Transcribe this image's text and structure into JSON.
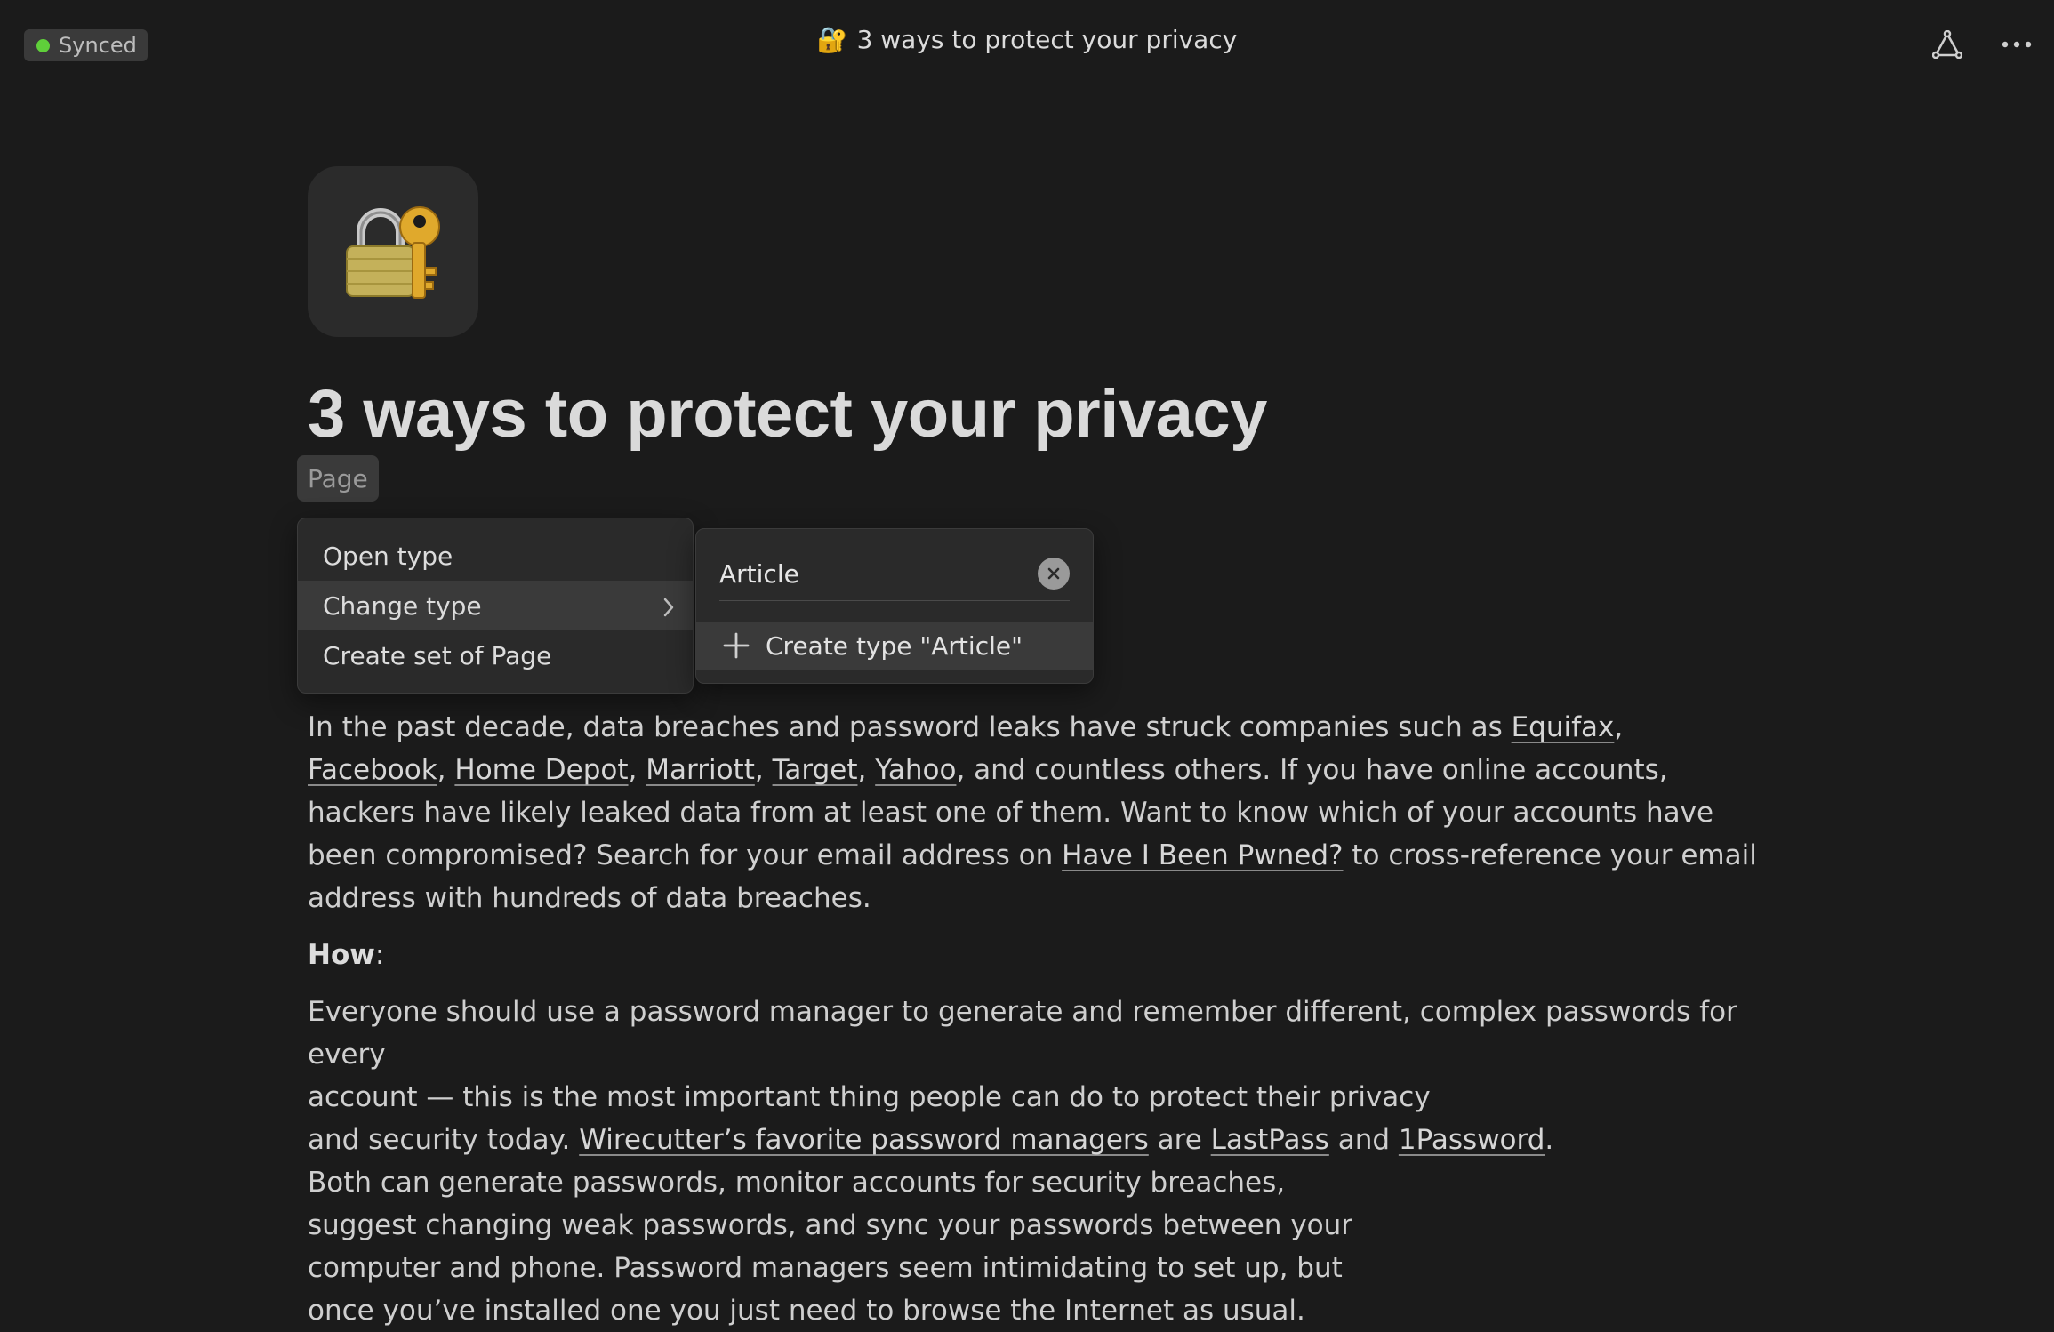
{
  "topbar": {
    "sync_status": "Synced",
    "doc_emoji": "🔐",
    "doc_title": "3 ways to protect your privacy",
    "status_color": "#5fcf3a"
  },
  "page": {
    "icon_emoji": "🔐",
    "title": "3 ways to protect your privacy",
    "type_label": "Page"
  },
  "menu": {
    "items": [
      {
        "label": "Open type"
      },
      {
        "label": "Change type"
      },
      {
        "label": "Create set of Page"
      }
    ]
  },
  "submenu": {
    "search_value": "Article",
    "create_label": "Create type \"Article\""
  },
  "body": {
    "p1": {
      "t1": "In the past decade, data breaches and password leaks have struck companies such as ",
      "l_equifax": "Equifax",
      "s1": ", ",
      "l_facebook": "Facebook",
      "s2": ", ",
      "l_homedepot": "Home Depot",
      "s3": ", ",
      "l_marriott": "Marriott",
      "s4": ", ",
      "l_target": "Target",
      "s5": ", ",
      "l_yahoo": "Yahoo",
      "t2": ", and countless others. If you have online accounts, hackers have likely leaked data from at least one of them. Want to know which of your accounts have been compromised? Search for your email address on ",
      "l_hibp": "Have I Been Pwned?",
      "t3": " to cross-reference your email address with hundreds of data breaches."
    },
    "how_label": "How",
    "how_colon": ":",
    "p2": {
      "line1": "Everyone should use a password manager to generate and remember different, complex passwords for every",
      "line2": "account — this is the most important thing people can do to protect their privacy",
      "line3_start": "and security today. ",
      "l_wirecutter": "Wirecutter’s favorite password managers",
      "line3_mid": " are ",
      "l_lastpass": "LastPass",
      "line3_and": " and ",
      "l_1password": "1Password",
      "line3_end": ".",
      "line4": "Both can generate passwords, monitor accounts for security breaches,",
      "line5": "suggest changing weak passwords, and sync your passwords between your",
      "line6": "computer and phone. Password managers seem intimidating to set up, but",
      "line7": "once you’ve installed one you just need to browse the Internet as usual."
    }
  }
}
